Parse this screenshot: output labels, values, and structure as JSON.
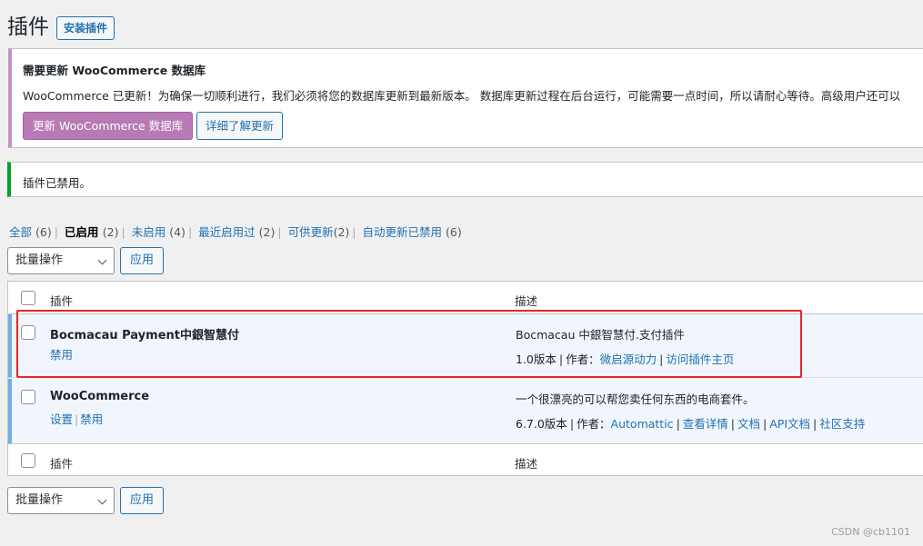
{
  "header": {
    "title": "插件",
    "add_button": "安装插件"
  },
  "woo_notice": {
    "title": "需要更新 WooCommerce 数据库",
    "text": "WooCommerce 已更新！为确保一切顺利进行，我们必须将您的数据库更新到最新版本。 数据库更新过程在后台运行，可能需要一点时间，所以请耐心等待。高级用户还可以",
    "update_button": "更新 WooCommerce 数据库",
    "learn_button": "详细了解更新"
  },
  "success_notice": {
    "text": "插件已禁用。"
  },
  "filters": [
    {
      "label": "全部",
      "count": "(6)",
      "current": false
    },
    {
      "label": "已启用",
      "count": "(2)",
      "current": true
    },
    {
      "label": "未启用",
      "count": "(4)",
      "current": false
    },
    {
      "label": "最近启用过",
      "count": "(2)",
      "current": false
    },
    {
      "label": "可供更新",
      "count": "(2)",
      "current": false
    },
    {
      "label": "自动更新已禁用",
      "count": "(6)",
      "current": false
    }
  ],
  "bulk": {
    "select_value": "批量操作",
    "apply_label": "应用"
  },
  "table": {
    "col_plugin": "插件",
    "col_description": "描述",
    "rows": [
      {
        "name": "Bocmacau Payment中銀智慧付",
        "actions": [
          "禁用"
        ],
        "description": "Bocmacau 中銀智慧付.支付插件",
        "version": "1.0版本",
        "author_prefix": "作者：",
        "author": "微启源动力",
        "links": [
          "访问插件主页"
        ]
      },
      {
        "name": "WooCommerce",
        "actions": [
          "设置",
          "禁用"
        ],
        "description": "一个很漂亮的可以帮您卖任何东西的电商套件。",
        "version": "6.7.0版本",
        "author_prefix": "作者：",
        "author": "Automattic",
        "links": [
          "查看详情",
          "文档",
          "API文档",
          "社区支持"
        ]
      }
    ]
  },
  "watermark": "CSDN @cb1101",
  "colors": {
    "accent": "#2271b1",
    "woo_purple": "#b77ab4",
    "success_green": "#00a32a",
    "active_row_border": "#72aee6",
    "highlight_red": "#e0272a"
  }
}
